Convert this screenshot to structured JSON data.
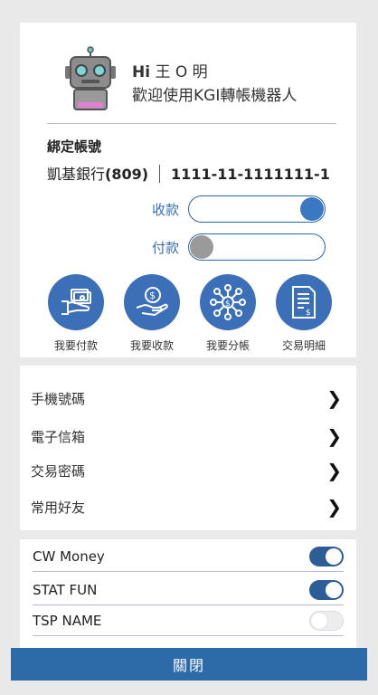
{
  "profile": {
    "greeting_hi": "Hi",
    "user_name": "王 O 明",
    "welcome": "歡迎使用KGI轉帳機器人",
    "icon": "robot-icon"
  },
  "binding": {
    "title": "綁定帳號",
    "bank_name": "凱基銀行",
    "bank_code": "(809)",
    "account": "1111-11-1111111-1"
  },
  "switches": {
    "receive_label": "收款",
    "receive_on": true,
    "pay_label": "付款",
    "pay_on": false
  },
  "actions": [
    {
      "label": "我要付款",
      "icon": "pay-cash-icon"
    },
    {
      "label": "我要收款",
      "icon": "receive-money-icon"
    },
    {
      "label": "我要分帳",
      "icon": "split-network-icon"
    },
    {
      "label": "交易明細",
      "icon": "transaction-doc-icon"
    }
  ],
  "menu": [
    {
      "label": "手機號碼"
    },
    {
      "label": "電子信箱"
    },
    {
      "label": "交易密碼"
    },
    {
      "label": "常用好友"
    }
  ],
  "toggles": [
    {
      "label": "CW Money",
      "on": true
    },
    {
      "label": "STAT FUN",
      "on": true
    },
    {
      "label": "TSP NAME",
      "on": false
    }
  ],
  "footer": {
    "close_label": "關閉"
  },
  "colors": {
    "accent": "#3b6fb8",
    "close_bar": "#2c6ba8",
    "toggle_on": "#2d5d96"
  }
}
